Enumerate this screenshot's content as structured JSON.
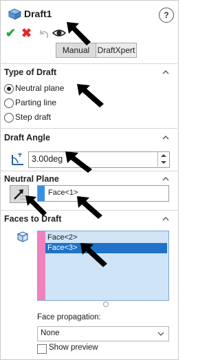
{
  "header": {
    "title": "Draft1",
    "help_label": "?",
    "manual_label": "Manual",
    "draftxpert_label": "DraftXpert"
  },
  "type_of_draft": {
    "heading": "Type of Draft",
    "options": [
      "Neutral plane",
      "Parting line",
      "Step draft"
    ],
    "selected": "Neutral plane"
  },
  "draft_angle": {
    "heading": "Draft Angle",
    "value": "3.00deg"
  },
  "neutral_plane": {
    "heading": "Neutral Plane",
    "value": "Face<1>"
  },
  "faces_to_draft": {
    "heading": "Faces to Draft",
    "items": [
      "Face<2>",
      "Face<3>"
    ],
    "selected_item": "Face<3>",
    "propagation_label": "Face propagation:",
    "propagation_value": "None",
    "show_preview_label": "Show preview"
  },
  "colors": {
    "accent": "#1e73c8",
    "ok_green": "#2aa34a",
    "cancel_red": "#e02a2a",
    "list_bg": "#cfe4f7",
    "list_marker": "#ee82bf"
  },
  "icons": [
    "draft-feature-icon",
    "help-icon",
    "ok-check-icon",
    "cancel-x-icon",
    "undo-icon",
    "preview-eye-icon",
    "collapse-chevron-icon",
    "angle-icon",
    "reverse-direction-icon",
    "face-selection-icon",
    "dropdown-chevron-icon"
  ]
}
